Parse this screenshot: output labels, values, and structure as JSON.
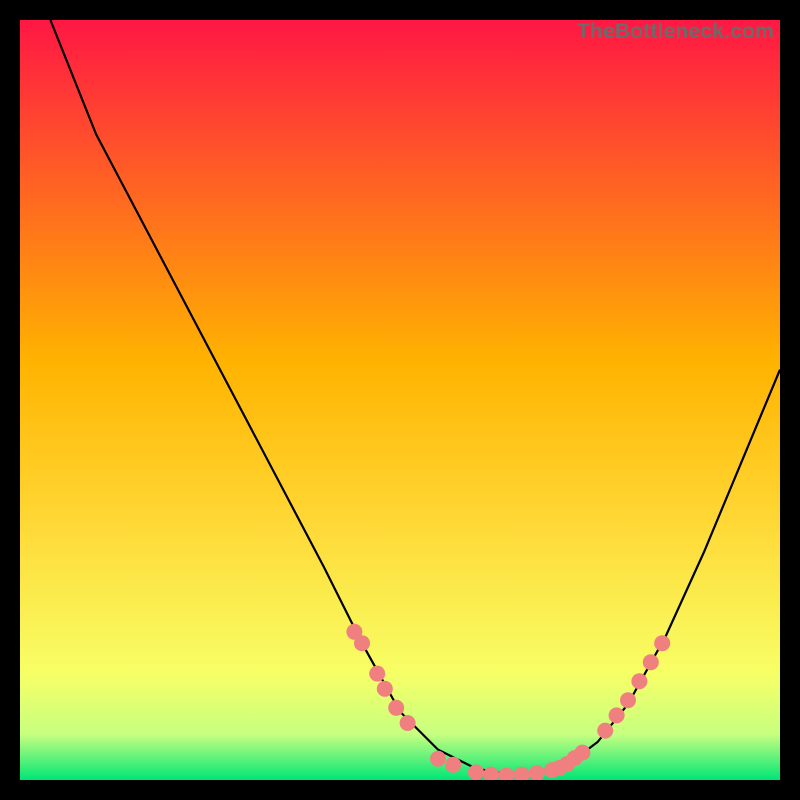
{
  "attribution": "TheBottleneck.com",
  "colors": {
    "frame": "#000000",
    "gradient_top": "#ff1744",
    "gradient_mid": "#ffd633",
    "gradient_low1": "#f7ff66",
    "gradient_low2": "#c7ff80",
    "gradient_bottom": "#00e676",
    "curve": "#000000",
    "dot_fill": "#f08080",
    "dot_stroke": "#e06666"
  },
  "chart_data": {
    "type": "line",
    "title": "",
    "xlabel": "",
    "ylabel": "",
    "xlim": [
      0,
      100
    ],
    "ylim": [
      0,
      100
    ],
    "series": [
      {
        "name": "curve",
        "x": [
          4,
          10,
          20,
          30,
          40,
          45,
          50,
          55,
          60,
          64,
          68,
          72,
          76,
          80,
          85,
          90,
          95,
          100
        ],
        "y": [
          100,
          85,
          66,
          47,
          28,
          18,
          9,
          4,
          1.5,
          0.8,
          1.0,
          2.0,
          5,
          10,
          19,
          30,
          42,
          54
        ]
      }
    ],
    "dots": {
      "name": "highlight-dots",
      "left_cluster": {
        "x": [
          44,
          45,
          47,
          48,
          49.5,
          51
        ],
        "y": [
          19.5,
          18,
          14,
          12,
          9.5,
          7.5
        ]
      },
      "valley_cluster": {
        "x": [
          55,
          57,
          60,
          62,
          64,
          66,
          68,
          70,
          71,
          72,
          73,
          74
        ],
        "y": [
          2.8,
          2.0,
          1.0,
          0.7,
          0.6,
          0.7,
          0.9,
          1.3,
          1.6,
          2.1,
          2.9,
          3.6
        ]
      },
      "right_cluster": {
        "x": [
          77,
          78.5,
          80,
          81.5,
          83,
          84.5
        ],
        "y": [
          6.5,
          8.5,
          10.5,
          13,
          15.5,
          18
        ]
      }
    }
  }
}
